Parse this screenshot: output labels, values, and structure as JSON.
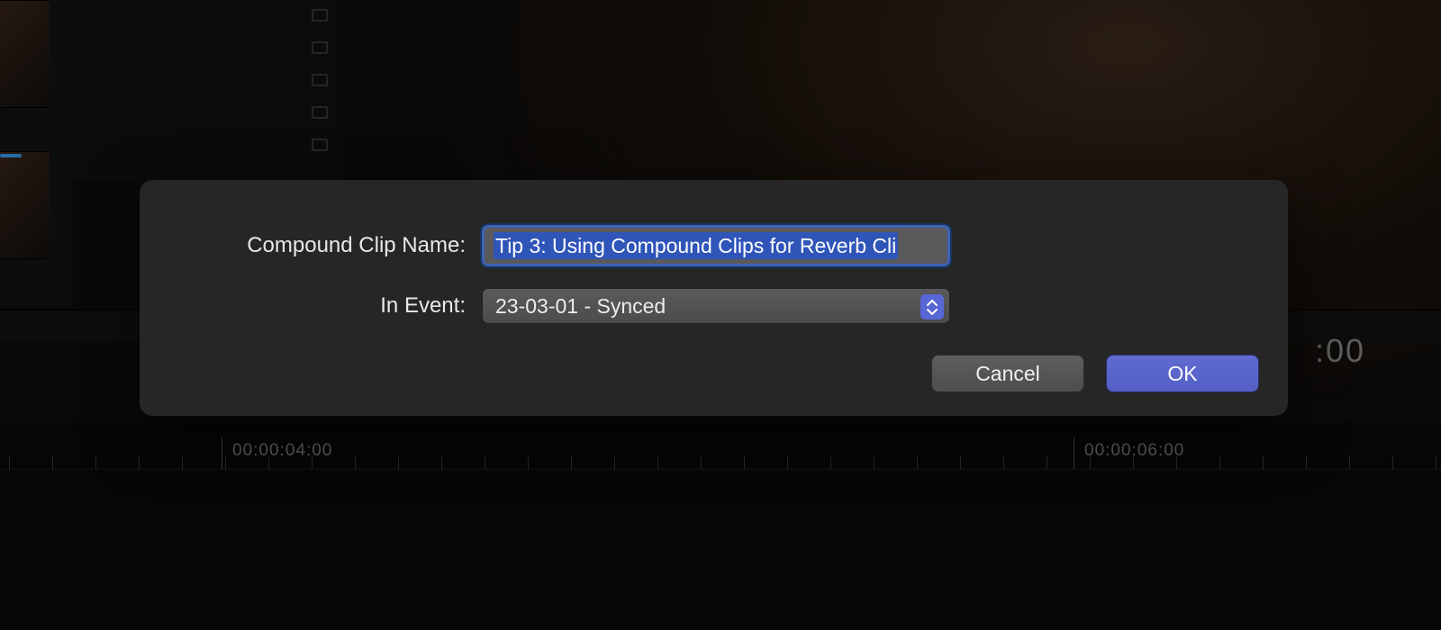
{
  "dialog": {
    "name_label": "Compound Clip Name:",
    "name_value": "Tip 3: Using Compound Clips for Reverb Cli",
    "event_label": "In Event:",
    "event_value": "23-03-01 - Synced",
    "cancel": "Cancel",
    "ok": "OK"
  },
  "timeline": {
    "tc_a": "00:00:04:00",
    "tc_b": "00:00:06:00"
  },
  "viewer": {
    "timecode_fragment": ":00"
  }
}
